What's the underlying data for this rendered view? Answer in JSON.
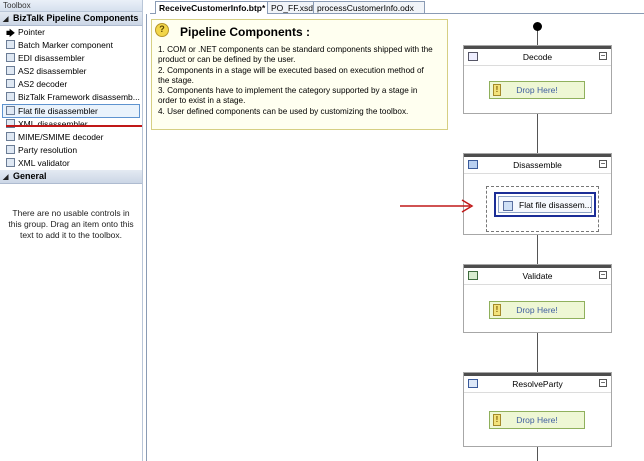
{
  "toolbox": {
    "title": "Toolbox",
    "sections": [
      {
        "name": "BizTalk Pipeline Components",
        "items": [
          {
            "label": "Pointer",
            "icon": "pointer-icon"
          },
          {
            "label": "Batch Marker component",
            "icon": "component-icon"
          },
          {
            "label": "EDI disassembler",
            "icon": "component-icon"
          },
          {
            "label": "AS2 disassembler",
            "icon": "component-icon"
          },
          {
            "label": "AS2 decoder",
            "icon": "component-icon"
          },
          {
            "label": "BizTalk Framework disassemb...",
            "icon": "component-icon"
          },
          {
            "label": "Flat file disassembler",
            "icon": "component-icon",
            "selected": true
          },
          {
            "label": "XML disassembler",
            "icon": "component-icon"
          },
          {
            "label": "MIME/SMIME decoder",
            "icon": "component-icon"
          },
          {
            "label": "Party resolution",
            "icon": "component-icon"
          },
          {
            "label": "XML validator",
            "icon": "component-icon"
          }
        ]
      },
      {
        "name": "General",
        "items": []
      }
    ],
    "empty_message": "There are no usable controls in this group. Drag an item onto this text to add it to the toolbox."
  },
  "tabs": [
    "ReceiveCustomerInfo.btp*",
    "PO_FF.xsd",
    "processCustomerInfo.odx"
  ],
  "note": {
    "title": "Pipeline Components :",
    "lines": [
      "1. COM or .NET components can be standard components shipped with the",
      "product or can be defined by the user.",
      "2. Components in a stage will be executed based on execution method of",
      "the stage.",
      "3. Components have to implement the category supported by a stage in",
      "order to exist in a stage.",
      "4. User defined components can be used by customizing the toolbox."
    ]
  },
  "stages": {
    "decode": {
      "title": "Decode",
      "drop": "Drop Here!"
    },
    "disassemble": {
      "title": "Disassemble",
      "component": "Flat file disassem..."
    },
    "validate": {
      "title": "Validate",
      "drop": "Drop Here!"
    },
    "resolveparty": {
      "title": "ResolveParty",
      "drop": "Drop Here!"
    }
  },
  "colors": {
    "highlight_red": "#c01818",
    "selection_blue": "#1b2d97"
  }
}
